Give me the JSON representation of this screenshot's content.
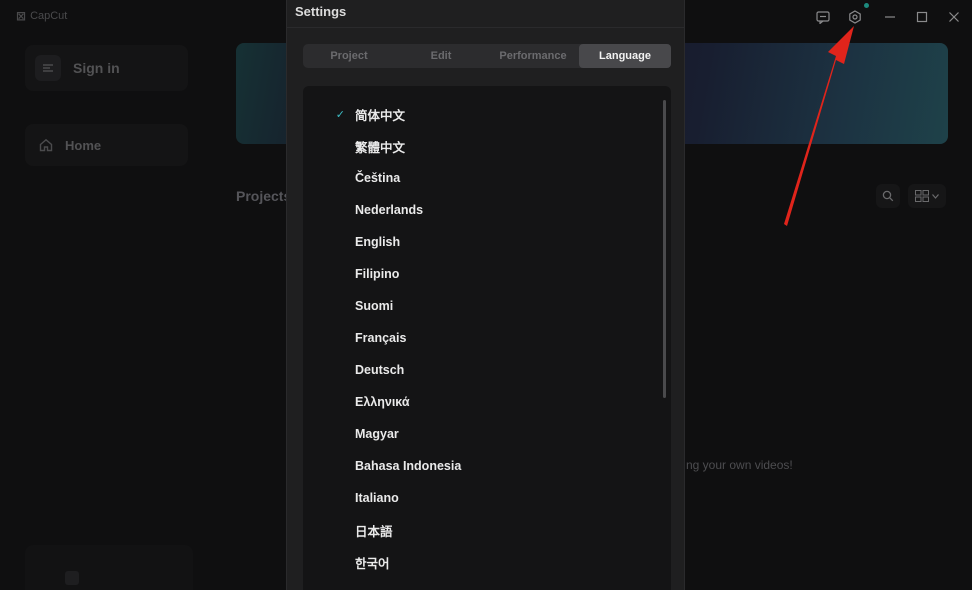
{
  "app": {
    "name": "CapCut"
  },
  "sidebar": {
    "sign_in_label": "Sign in",
    "home_label": "Home"
  },
  "main": {
    "projects_title": "Projects",
    "empty_text": "ng your own videos!"
  },
  "settings": {
    "title": "Settings",
    "tabs": [
      {
        "label": "Project",
        "active": false
      },
      {
        "label": "Edit",
        "active": false
      },
      {
        "label": "Performance",
        "active": false
      },
      {
        "label": "Language",
        "active": true
      }
    ],
    "languages": [
      {
        "label": "简体中文",
        "selected": true
      },
      {
        "label": "繁體中文",
        "selected": false
      },
      {
        "label": "Čeština",
        "selected": false
      },
      {
        "label": "Nederlands",
        "selected": false
      },
      {
        "label": "English",
        "selected": false
      },
      {
        "label": "Filipino",
        "selected": false
      },
      {
        "label": "Suomi",
        "selected": false
      },
      {
        "label": "Français",
        "selected": false
      },
      {
        "label": "Deutsch",
        "selected": false
      },
      {
        "label": "Ελληνικά",
        "selected": false
      },
      {
        "label": "Magyar",
        "selected": false
      },
      {
        "label": "Bahasa Indonesia",
        "selected": false
      },
      {
        "label": "Italiano",
        "selected": false
      },
      {
        "label": "日本語",
        "selected": false
      },
      {
        "label": "한국어",
        "selected": false
      }
    ],
    "check_glyph": "✓"
  },
  "colors": {
    "accent": "#3dbcc4",
    "annotation_arrow": "#e0241b"
  },
  "icons": [
    "feedback-icon",
    "settings-gear-icon",
    "minimize-icon",
    "maximize-icon",
    "close-icon",
    "home-icon",
    "search-icon",
    "grid-view-icon"
  ]
}
